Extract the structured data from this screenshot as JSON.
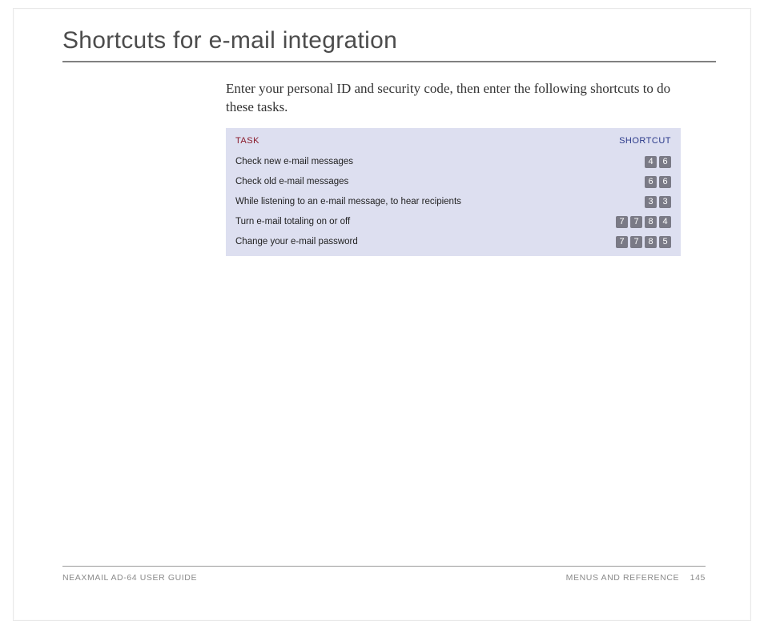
{
  "heading": "Shortcuts for e-mail integration",
  "intro": "Enter your personal ID and security code, then enter the following shortcuts to do these tasks.",
  "table": {
    "head_task": "TASK",
    "head_shortcut": "SHORTCUT",
    "rows": [
      {
        "task": "Check new e-mail messages",
        "keys": [
          "4",
          "6"
        ]
      },
      {
        "task": "Check old e-mail messages",
        "keys": [
          "6",
          "6"
        ]
      },
      {
        "task": "While listening to an e-mail message, to hear recipients",
        "keys": [
          "3",
          "3"
        ]
      },
      {
        "task": "Turn e-mail totaling on or off",
        "keys": [
          "7",
          "7",
          "8",
          "4"
        ]
      },
      {
        "task": "Change your e-mail password",
        "keys": [
          "7",
          "7",
          "8",
          "5"
        ]
      }
    ]
  },
  "footer": {
    "left": "NEAXMAIL AD-64 USER GUIDE",
    "right_section": "MENUS AND REFERENCE",
    "page": "145"
  }
}
